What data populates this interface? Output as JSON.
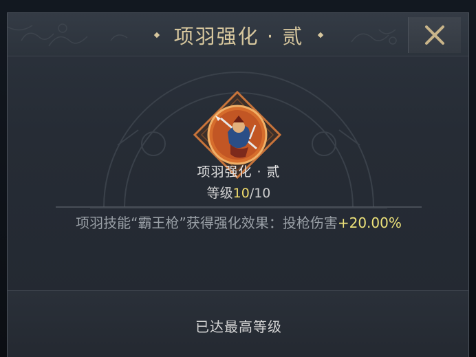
{
  "dialog": {
    "title": "项羽强化 · 贰",
    "close_icon": "close-x-icon"
  },
  "skill": {
    "name": "项羽强化 · 贰",
    "level_label": "等级",
    "level_current": "10",
    "level_max": "/10",
    "icon": "hero-spear-portrait-icon",
    "effect_text": "项羽技能“霸王枪”获得强化效果：投枪伤害",
    "effect_value": "+20.00%"
  },
  "footer": {
    "status": "已达最高等级"
  },
  "colors": {
    "panel": "#2a3039",
    "title_gold": "#d7c79e",
    "value_yellow": "#ede27a",
    "frame_orange": "#c9743a"
  }
}
